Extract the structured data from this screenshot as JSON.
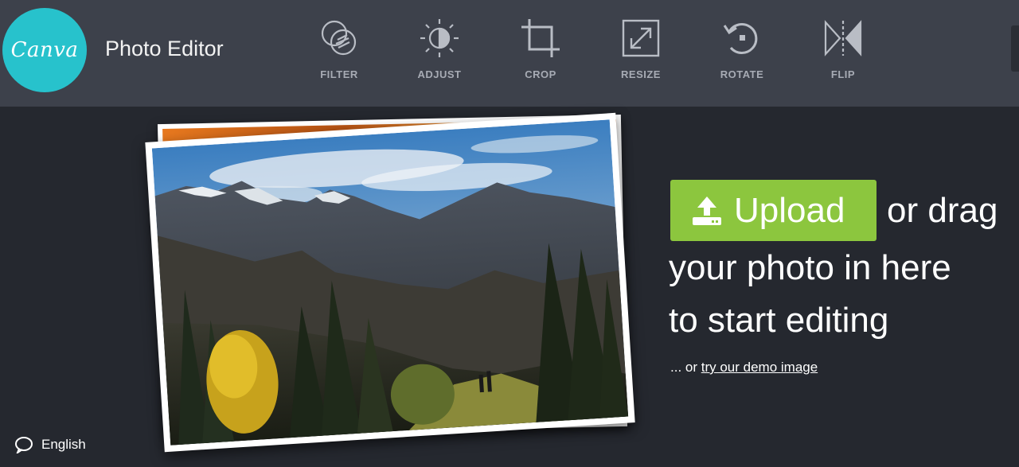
{
  "header": {
    "logo_text": "Canva",
    "app_title": "Photo Editor",
    "tools": [
      {
        "label": "FILTER",
        "icon": "filter-icon"
      },
      {
        "label": "ADJUST",
        "icon": "adjust-icon"
      },
      {
        "label": "CROP",
        "icon": "crop-icon"
      },
      {
        "label": "RESIZE",
        "icon": "resize-icon"
      },
      {
        "label": "ROTATE",
        "icon": "rotate-icon"
      },
      {
        "label": "FLIP",
        "icon": "flip-icon"
      }
    ]
  },
  "main": {
    "upload_label": "Upload",
    "upload_icon": "upload-icon",
    "or_drag": "or drag",
    "line2": "your photo in here",
    "line3": "to start editing",
    "demo_prefix": "... or ",
    "demo_link": "try our demo image",
    "preview_image": "mountain-landscape-photo"
  },
  "footer": {
    "language": "English",
    "language_icon": "speech-bubble-icon"
  },
  "colors": {
    "header_bg": "#3d414b",
    "page_bg": "#25282f",
    "logo_bg": "#27c2cc",
    "upload_bg": "#8cc63e",
    "tool_label": "#a7abb4"
  }
}
